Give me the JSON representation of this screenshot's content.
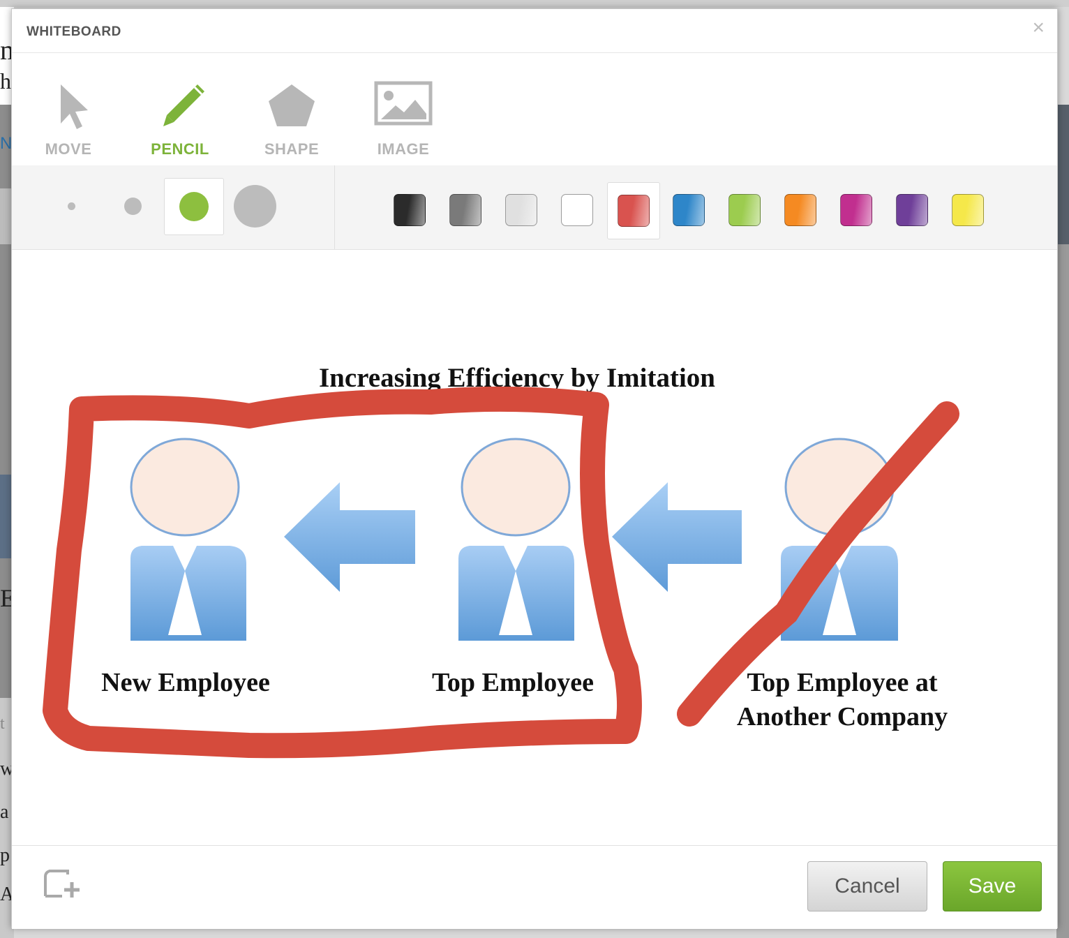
{
  "background": {
    "edge_glyphs": [
      "m",
      "h",
      "N",
      "E",
      "t",
      "w",
      "a",
      "p",
      "A"
    ]
  },
  "modal": {
    "title": "WHITEBOARD",
    "close_icon": "close-icon"
  },
  "tools": [
    {
      "id": "move",
      "label": "MOVE",
      "icon": "cursor-arrow-icon",
      "active": false
    },
    {
      "id": "pencil",
      "label": "PENCIL",
      "icon": "pencil-icon",
      "active": true
    },
    {
      "id": "shape",
      "label": "SHAPE",
      "icon": "pentagon-icon",
      "active": false
    },
    {
      "id": "image",
      "label": "IMAGE",
      "icon": "image-icon",
      "active": false
    }
  ],
  "brush_sizes": {
    "options": [
      "extra-small",
      "small",
      "medium",
      "large"
    ],
    "selected": "medium",
    "active_color": "#8dbf3f"
  },
  "colors": {
    "options": [
      "#2b2b2b",
      "#7a7a7a",
      "#e0e0e0",
      "#ffffff",
      "#d9534f",
      "#2e86c9",
      "#9ccc4f",
      "#f58a22",
      "#c12f8f",
      "#6f3f99",
      "#f5e84a"
    ],
    "selected": "#d9534f"
  },
  "canvas": {
    "diagram_title": "Increasing Efficiency by Imitation",
    "figures": [
      "New Employee",
      "Top Employee",
      "Top Employee at Another Company"
    ],
    "third_label_line1": "Top Employee at",
    "third_label_line2": "Another Company",
    "stroke_color": "#d54b3c"
  },
  "footer": {
    "new_board_icon": "new-board-icon",
    "cancel_label": "Cancel",
    "save_label": "Save"
  }
}
